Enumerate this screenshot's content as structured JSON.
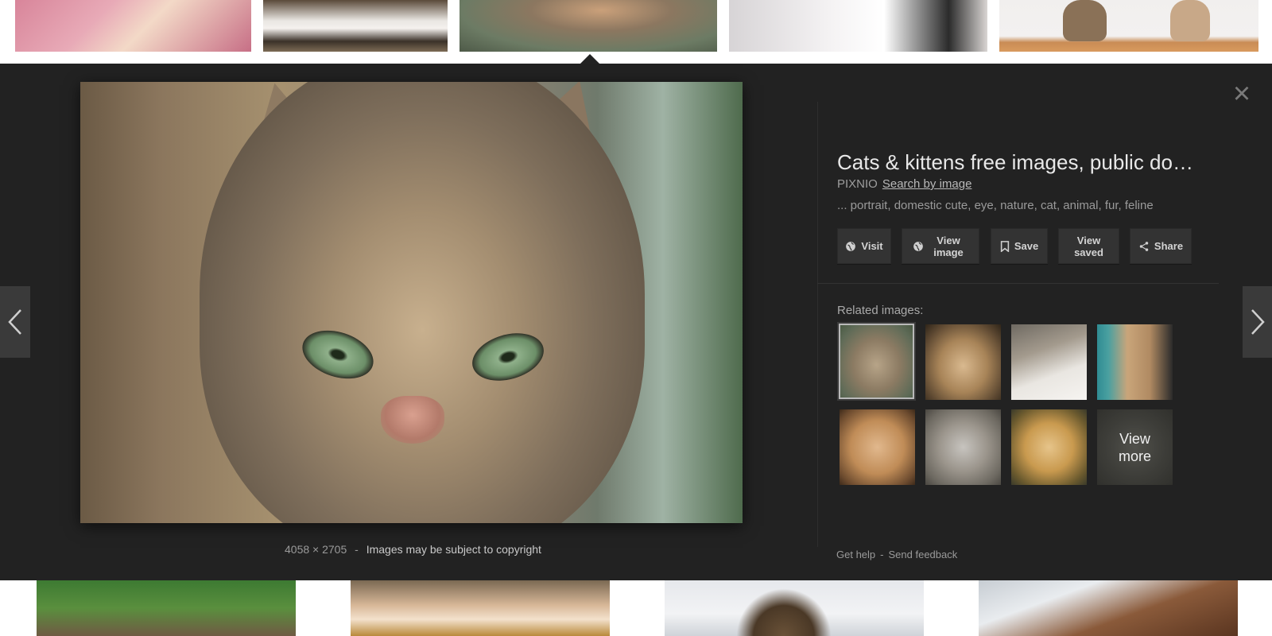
{
  "preview": {
    "title": "Cats & kittens free images, public do…",
    "source": "PIXNIO",
    "search_by_image": "Search by image",
    "description": "... portrait, domestic cute, eye, nature, cat, animal, fur, feline",
    "dimensions": "4058 × 2705",
    "separator": "-",
    "copyright": "Images may be subject to copyright",
    "close_icon": "×"
  },
  "actions": {
    "visit": "Visit",
    "view_image": "View image",
    "save": "Save",
    "view_saved": "View saved",
    "share": "Share"
  },
  "related": {
    "label": "Related images:",
    "view_more": "View more"
  },
  "footer": {
    "get_help": "Get help",
    "separator": "-",
    "send_feedback": "Send feedback"
  },
  "colors": {
    "panel_bg": "#222222",
    "button_bg": "#333333",
    "title_text": "#e8e8e8"
  }
}
